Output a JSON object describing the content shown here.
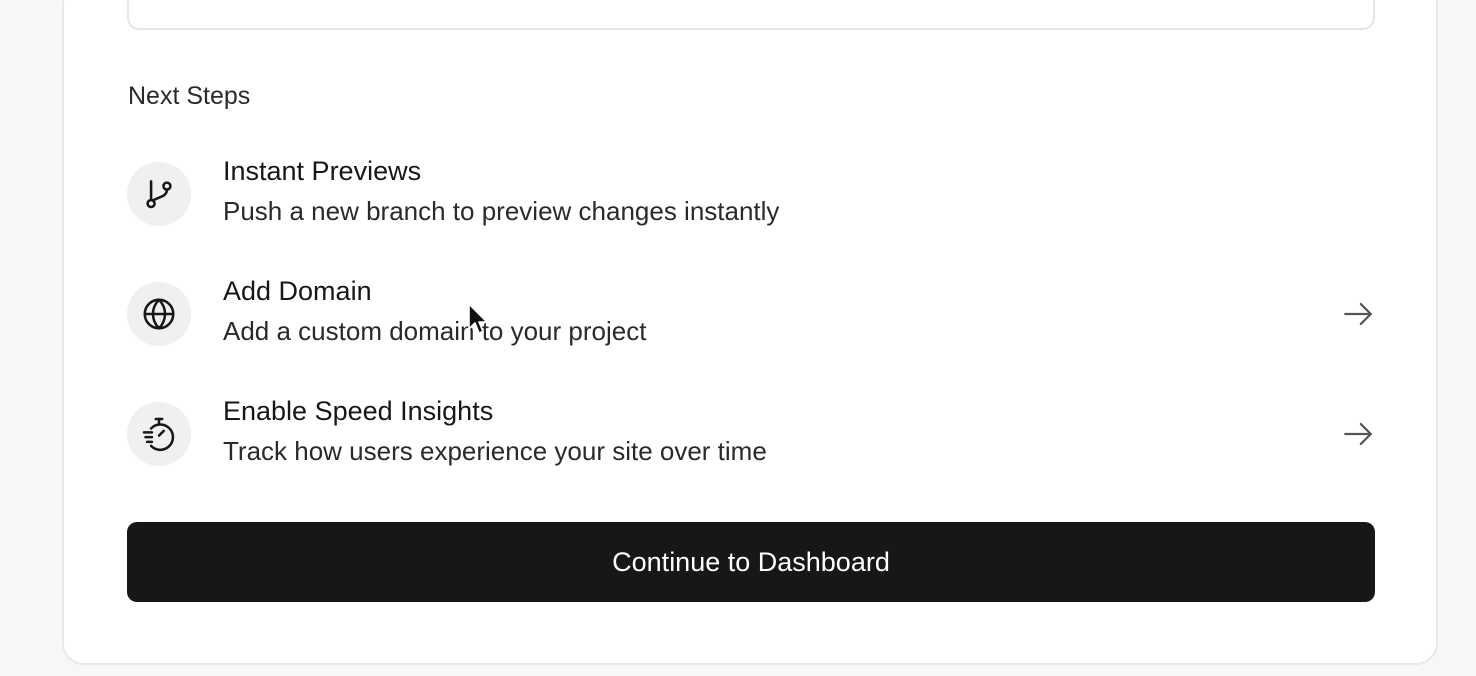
{
  "next_steps": {
    "heading": "Next Steps",
    "items": [
      {
        "title": "Instant Previews",
        "description": "Push a new branch to preview changes instantly",
        "icon": "git-branch-icon",
        "has_arrow": false
      },
      {
        "title": "Add Domain",
        "description": "Add a custom domain to your project",
        "icon": "globe-icon",
        "has_arrow": true
      },
      {
        "title": "Enable Speed Insights",
        "description": "Track how users experience your site over time",
        "icon": "stopwatch-icon",
        "has_arrow": true
      }
    ]
  },
  "primary_action": {
    "label": "Continue to Dashboard"
  },
  "colors": {
    "page_background": "#f7f7f7",
    "card_background": "#ffffff",
    "icon_circle": "#f0f0f0",
    "button_background": "#171717",
    "button_text": "#ffffff",
    "text_primary": "#171717"
  }
}
